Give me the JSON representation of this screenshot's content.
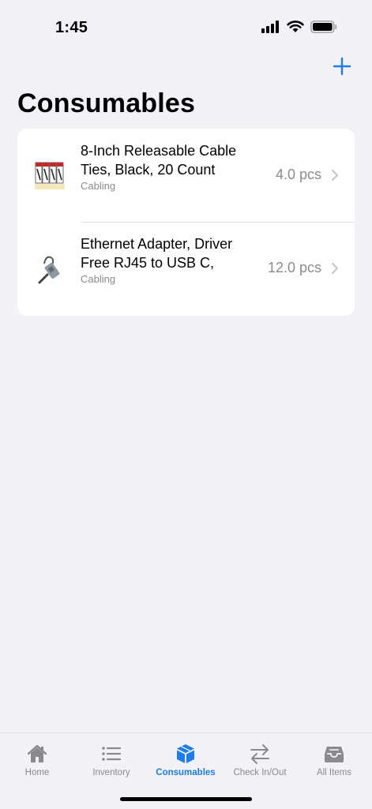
{
  "status_bar": {
    "time": "1:45"
  },
  "header": {
    "title": "Consumables",
    "add_icon": "plus-icon"
  },
  "items": [
    {
      "name": "8-Inch Releasable Cable Ties, Black, 20 Count",
      "category": "Cabling",
      "quantity": "4.0 pcs"
    },
    {
      "name": "Ethernet Adapter, Driver Free RJ45 to USB C,",
      "category": "Cabling",
      "quantity": "12.0 pcs"
    }
  ],
  "tab_bar": {
    "tabs": [
      {
        "label": "Home",
        "icon": "house-icon"
      },
      {
        "label": "Inventory",
        "icon": "list-icon"
      },
      {
        "label": "Consumables",
        "icon": "box-icon",
        "active": true
      },
      {
        "label": "Check In/Out",
        "icon": "arrows-icon"
      },
      {
        "label": "All Items",
        "icon": "tray-icon"
      }
    ]
  },
  "colors": {
    "accent": "#1c7ced",
    "inactive": "#8a8a8e",
    "background": "#f2f1f6"
  }
}
